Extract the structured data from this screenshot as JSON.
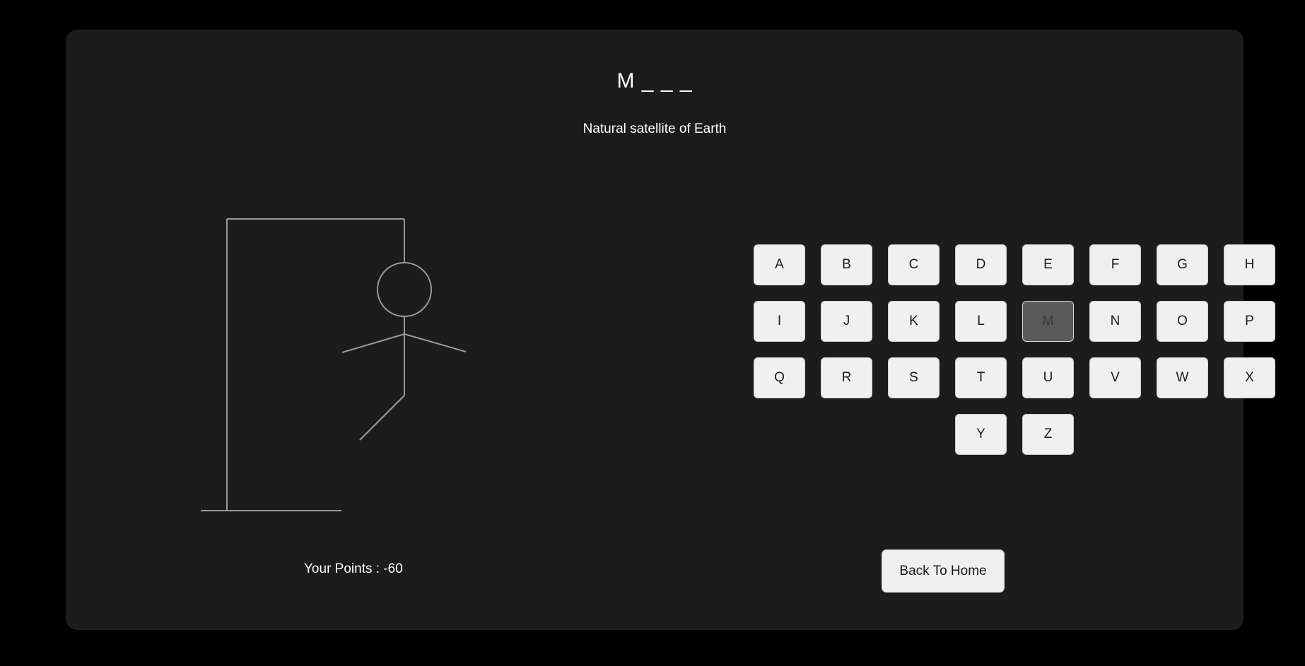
{
  "game": {
    "word_display": "M _ _ _",
    "hint": "Natural satellite of Earth",
    "points_text": "Your Points : -60",
    "back_button_label": "Back To Home",
    "wrong_guesses_shown": 7,
    "colors": {
      "page_background": "#000000",
      "panel_background": "#1c1c1c",
      "key_background": "#f0f0f0",
      "key_used_background": "#5a5a5a",
      "drawing_stroke": "#9a9a9a",
      "text": "#ffffff"
    }
  },
  "keyboard": {
    "keys": [
      {
        "label": "A",
        "used": false
      },
      {
        "label": "B",
        "used": false
      },
      {
        "label": "C",
        "used": false
      },
      {
        "label": "D",
        "used": false
      },
      {
        "label": "E",
        "used": false
      },
      {
        "label": "F",
        "used": false
      },
      {
        "label": "G",
        "used": false
      },
      {
        "label": "H",
        "used": false
      },
      {
        "label": "I",
        "used": false
      },
      {
        "label": "J",
        "used": false
      },
      {
        "label": "K",
        "used": false
      },
      {
        "label": "L",
        "used": false
      },
      {
        "label": "M",
        "used": true
      },
      {
        "label": "N",
        "used": false
      },
      {
        "label": "O",
        "used": false
      },
      {
        "label": "P",
        "used": false
      },
      {
        "label": "Q",
        "used": false
      },
      {
        "label": "R",
        "used": false
      },
      {
        "label": "S",
        "used": false
      },
      {
        "label": "T",
        "used": false
      },
      {
        "label": "U",
        "used": false
      },
      {
        "label": "V",
        "used": false
      },
      {
        "label": "W",
        "used": false
      },
      {
        "label": "X",
        "used": false
      },
      {
        "label": "Y",
        "used": false
      },
      {
        "label": "Z",
        "used": false
      }
    ]
  }
}
